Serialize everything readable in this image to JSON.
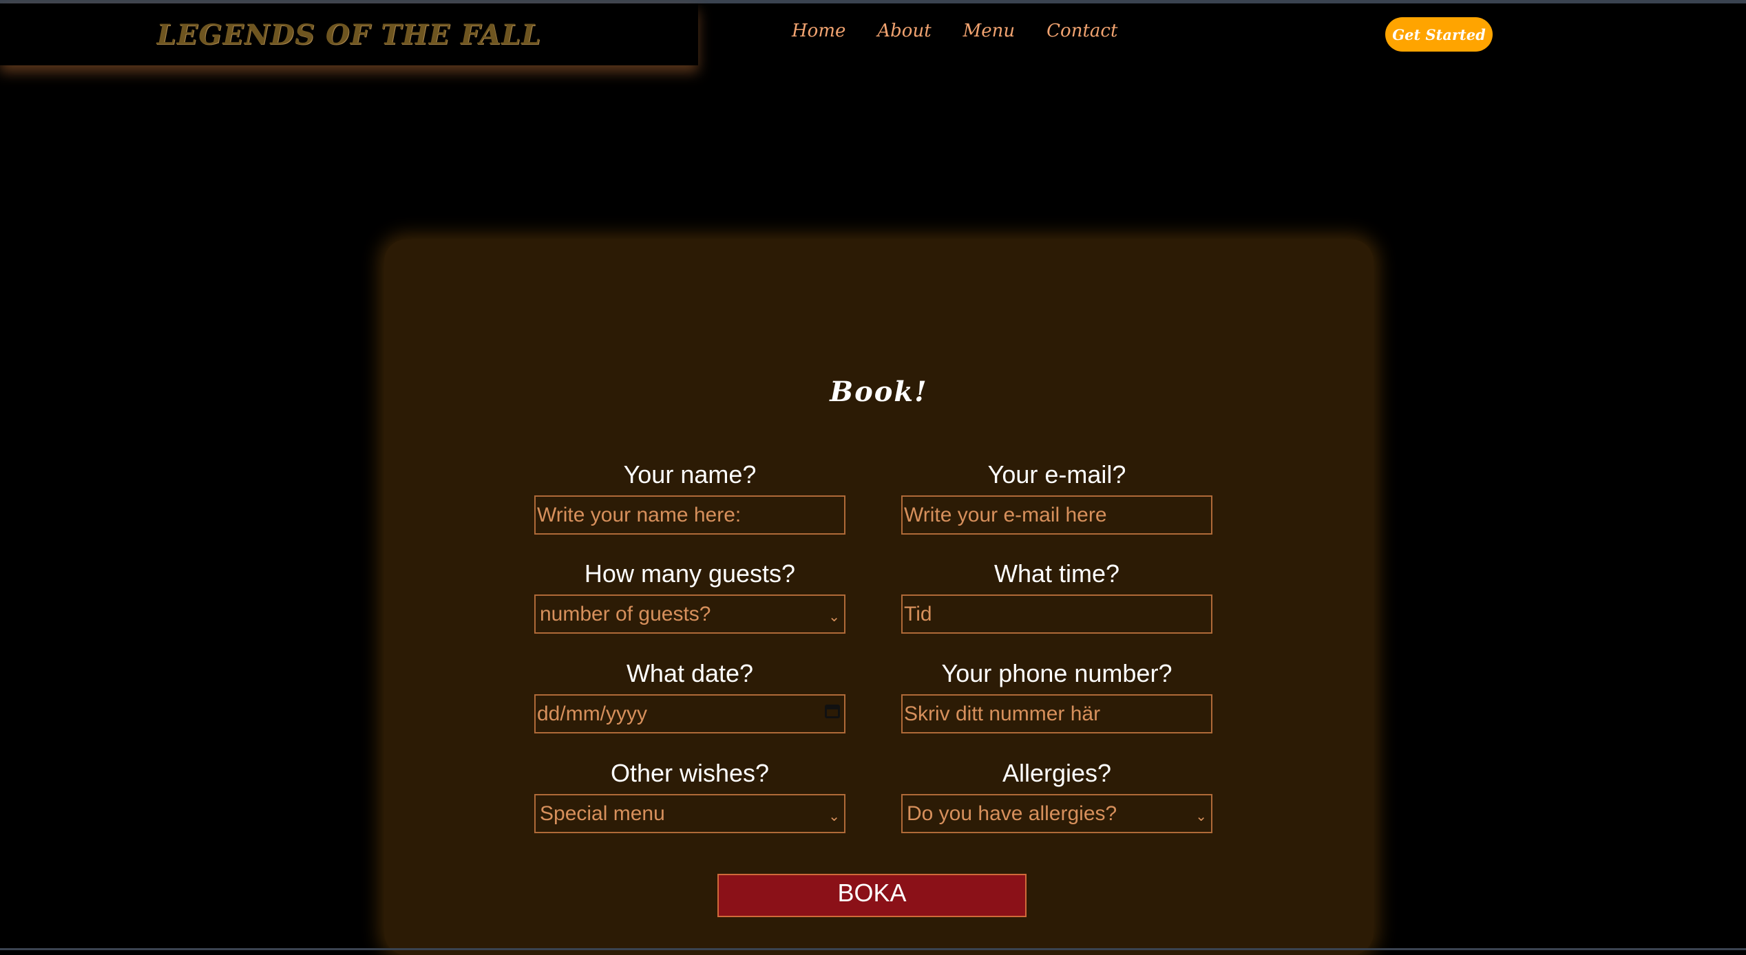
{
  "header": {
    "logo_text": "LEGENDS OF THE FALL",
    "nav": [
      "Home",
      "About",
      "Menu",
      "Contact"
    ],
    "cta_label": "Get Started"
  },
  "form": {
    "title": "Book!",
    "name": {
      "label": "Your name?",
      "placeholder": "Write your name here:"
    },
    "email": {
      "label": "Your e-mail?",
      "placeholder": "Write your e-mail here"
    },
    "guests": {
      "label": "How many guests?",
      "selected": "number of guests?"
    },
    "time": {
      "label": "What time?",
      "placeholder": "Tid"
    },
    "date": {
      "label": "What date?",
      "placeholder": "dd/mm/yyyy"
    },
    "phone": {
      "label": "Your phone number?",
      "placeholder": "Skriv ditt nummer här"
    },
    "wishes": {
      "label": "Other wishes?",
      "selected": "Special menu"
    },
    "allergies": {
      "label": "Allergies?",
      "selected": "Do you have allergies?"
    },
    "submit_label": "BOKA"
  },
  "colors": {
    "background": "#000000",
    "card": "#2c1b05",
    "accent": "#ffa400",
    "nav_text": "#f1a370",
    "field_border": "#b06a38",
    "submit": "#8b1118"
  }
}
